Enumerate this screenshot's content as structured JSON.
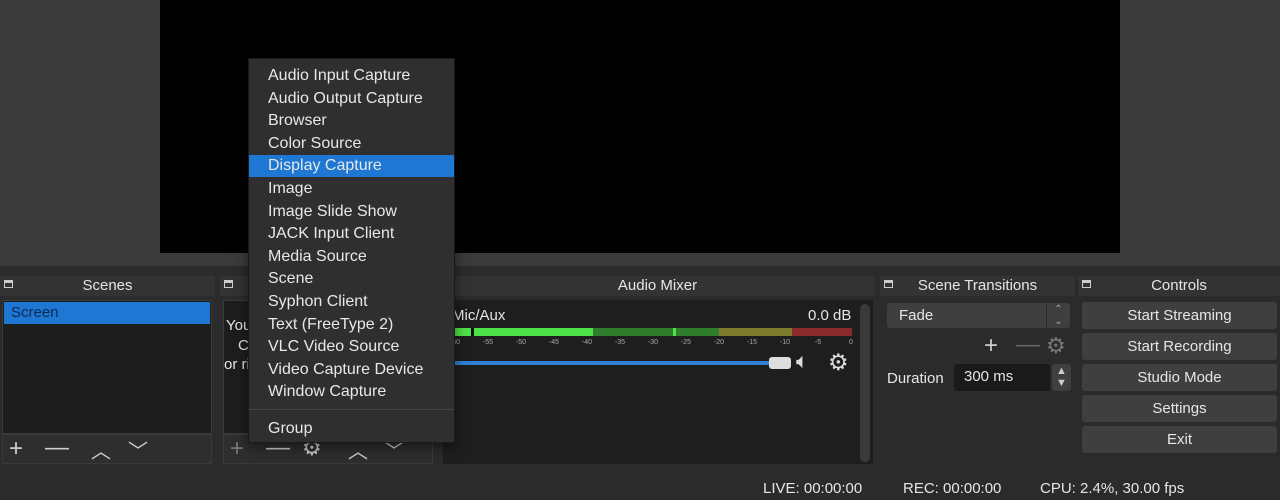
{
  "scenes": {
    "title": "Scenes",
    "items": [
      "Screen"
    ],
    "selected": 0
  },
  "sources": {
    "hint_fragments": [
      "You",
      "C",
      "or ri"
    ]
  },
  "audio_mixer": {
    "title": "Audio Mixer",
    "channel": "Mic/Aux",
    "level": "0.0 dB",
    "scale": [
      "-60",
      "-55",
      "-50",
      "-45",
      "-40",
      "-35",
      "-30",
      "-25",
      "-20",
      "-15",
      "-10",
      "-5",
      "0"
    ],
    "volume_fraction": 1.0,
    "colors": {
      "green": "#4fe14a",
      "dark_green": "#2f7d2d",
      "yellow": "#7d7a2c",
      "red": "#8a2a2a",
      "fader": "#2f7fd6"
    }
  },
  "transitions": {
    "title": "Scene Transitions",
    "selected": "Fade",
    "duration_label": "Duration",
    "duration_value": "300 ms"
  },
  "controls": {
    "title": "Controls",
    "buttons": [
      "Start Streaming",
      "Start Recording",
      "Studio Mode",
      "Settings",
      "Exit"
    ]
  },
  "menu": {
    "items": [
      "Audio Input Capture",
      "Audio Output Capture",
      "Browser",
      "Color Source",
      "Display Capture",
      "Image",
      "Image Slide Show",
      "JACK Input Client",
      "Media Source",
      "Scene",
      "Syphon Client",
      "Text (FreeType 2)",
      "VLC Video Source",
      "Video Capture Device",
      "Window Capture"
    ],
    "highlighted": "Display Capture",
    "extra": "Group",
    "highlight_color": "#1d77d3"
  },
  "status": {
    "live": "LIVE: 00:00:00",
    "rec": "REC: 00:00:00",
    "cpu": "CPU: 2.4%, 30.00 fps"
  }
}
